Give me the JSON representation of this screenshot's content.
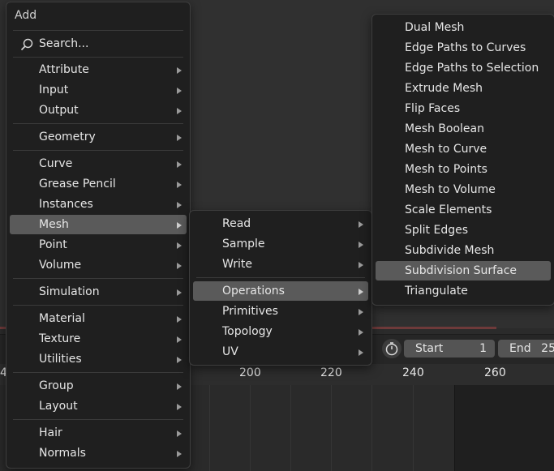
{
  "add_menu": {
    "title": "Add",
    "search_label": "Search...",
    "items": [
      {
        "label": "Attribute"
      },
      {
        "label": "Input"
      },
      {
        "label": "Output"
      },
      {
        "label": "Geometry"
      },
      {
        "label": "Curve"
      },
      {
        "label": "Grease Pencil"
      },
      {
        "label": "Instances"
      },
      {
        "label": "Mesh"
      },
      {
        "label": "Point"
      },
      {
        "label": "Volume"
      },
      {
        "label": "Simulation"
      },
      {
        "label": "Material"
      },
      {
        "label": "Texture"
      },
      {
        "label": "Utilities"
      },
      {
        "label": "Group"
      },
      {
        "label": "Layout"
      },
      {
        "label": "Hair"
      },
      {
        "label": "Normals"
      }
    ]
  },
  "mesh_menu": {
    "items": [
      {
        "label": "Read"
      },
      {
        "label": "Sample"
      },
      {
        "label": "Write"
      },
      {
        "label": "Operations"
      },
      {
        "label": "Primitives"
      },
      {
        "label": "Topology"
      },
      {
        "label": "UV"
      }
    ]
  },
  "operations_menu": {
    "items": [
      {
        "label": "Dual Mesh"
      },
      {
        "label": "Edge Paths to Curves"
      },
      {
        "label": "Edge Paths to Selection"
      },
      {
        "label": "Extrude Mesh"
      },
      {
        "label": "Flip Faces"
      },
      {
        "label": "Mesh Boolean"
      },
      {
        "label": "Mesh to Curve"
      },
      {
        "label": "Mesh to Points"
      },
      {
        "label": "Mesh to Volume"
      },
      {
        "label": "Scale Elements"
      },
      {
        "label": "Split Edges"
      },
      {
        "label": "Subdivide Mesh"
      },
      {
        "label": "Subdivision Surface"
      },
      {
        "label": "Triangulate"
      }
    ]
  },
  "timeline": {
    "start_label": "Start",
    "start_value": "1",
    "end_label": "End",
    "end_value": "25",
    "ticks": [
      "4",
      "200",
      "220",
      "240",
      "260"
    ]
  },
  "icons": {
    "search": "magnifier-icon",
    "timer": "stopwatch-icon",
    "submenu": "triangle-right-icon"
  }
}
